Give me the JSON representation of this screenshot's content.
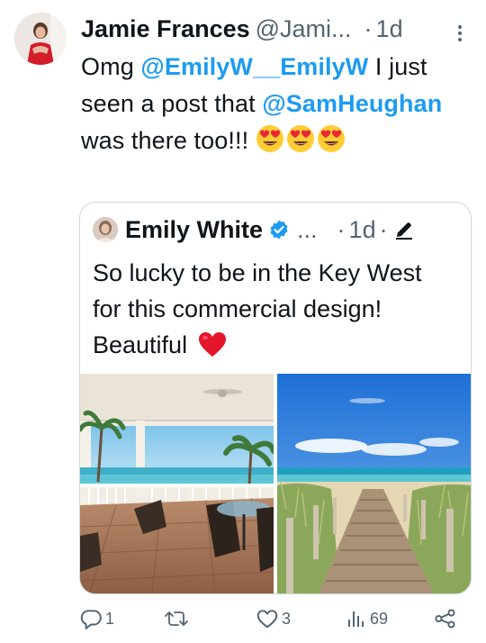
{
  "tweet": {
    "author_name": "Jamie Frances",
    "author_handle": "@Jami...",
    "dot": "·",
    "time": "1d",
    "text_before": "Omg ",
    "mention_1": "@EmilyW__EmilyW",
    "text_middle": " I just seen a post that ",
    "mention_2": "@SamHeughan",
    "text_after": " was there too!!!",
    "emojis": [
      "heart-eyes-emoji",
      "heart-eyes-emoji",
      "heart-eyes-emoji"
    ]
  },
  "quote": {
    "author_name": "Emily White",
    "ellipsis": "...",
    "dot": "·",
    "time": "1d",
    "dot2": "·",
    "text": "So lucky to be in the Key West for this commercial design! Beautiful",
    "emoji": "red-heart-emoji",
    "images": [
      "balcony-ocean-view-photo",
      "beach-boardwalk-photo"
    ]
  },
  "actions": {
    "replies": "1",
    "retweets": "",
    "likes": "3",
    "views": "69"
  },
  "colors": {
    "text": "#0f1419",
    "muted": "#536471",
    "mention": "#1d9bf0",
    "border": "#cfd9de",
    "verified": "#1d9bf0"
  },
  "icons": [
    "more-icon",
    "verified-badge-icon",
    "edit-icon",
    "reply-icon",
    "retweet-icon",
    "like-icon",
    "views-icon",
    "share-icon"
  ]
}
